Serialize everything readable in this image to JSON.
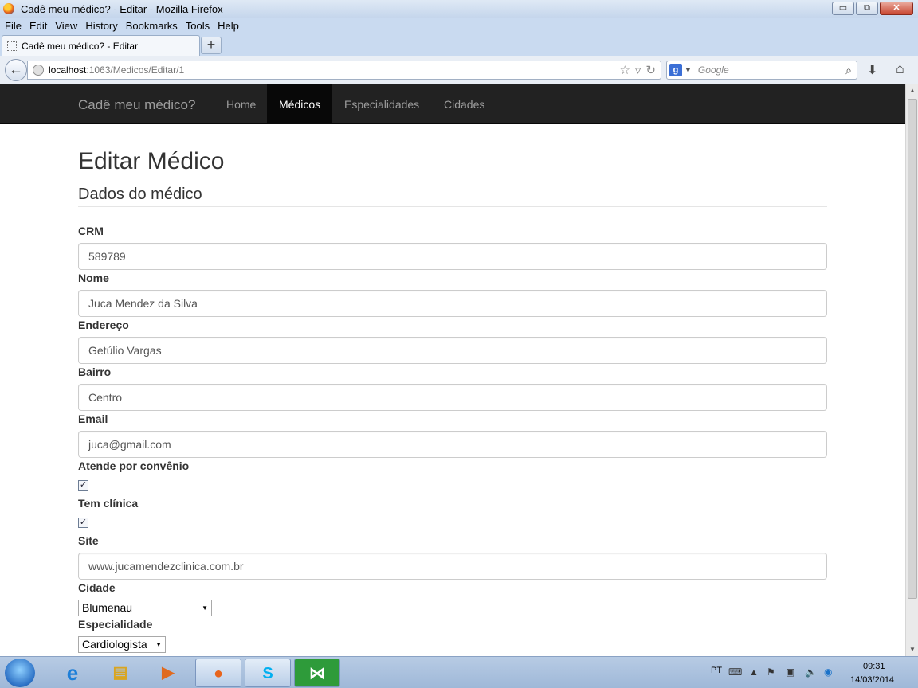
{
  "window": {
    "title": "Cadê meu médico? - Editar - Mozilla Firefox",
    "minimize": "▭",
    "restore": "⧉",
    "close": "✕"
  },
  "menu": [
    "File",
    "Edit",
    "View",
    "History",
    "Bookmarks",
    "Tools",
    "Help"
  ],
  "tab": {
    "title": "Cadê meu médico? - Editar",
    "new_tab": "+"
  },
  "nav": {
    "url_host": "localhost",
    "url_rest": ":1063/Medicos/Editar/1",
    "search_placeholder": "Google"
  },
  "site": {
    "brand": "Cadê meu médico?",
    "menu": [
      {
        "label": "Home",
        "active": false
      },
      {
        "label": "Médicos",
        "active": true
      },
      {
        "label": "Especialidades",
        "active": false
      },
      {
        "label": "Cidades",
        "active": false
      }
    ]
  },
  "form": {
    "heading": "Editar Médico",
    "subheading": "Dados do médico",
    "crm_label": "CRM",
    "crm_value": "589789",
    "nome_label": "Nome",
    "nome_value": "Juca Mendez da Silva",
    "endereco_label": "Endereço",
    "endereco_value": "Getúlio Vargas",
    "bairro_label": "Bairro",
    "bairro_value": "Centro",
    "email_label": "Email",
    "email_value": "juca@gmail.com",
    "convenio_label": "Atende por convênio",
    "convenio_checked": true,
    "clinica_label": "Tem clínica",
    "clinica_checked": true,
    "site_label": "Site",
    "site_value": "www.jucamendezclinica.com.br",
    "cidade_label": "Cidade",
    "cidade_value": "Blumenau",
    "especialidade_label": "Especialidade",
    "especialidade_value": "Cardiologista"
  },
  "taskbar": {
    "language": "PT",
    "time": "09:31",
    "date": "14/03/2014"
  }
}
